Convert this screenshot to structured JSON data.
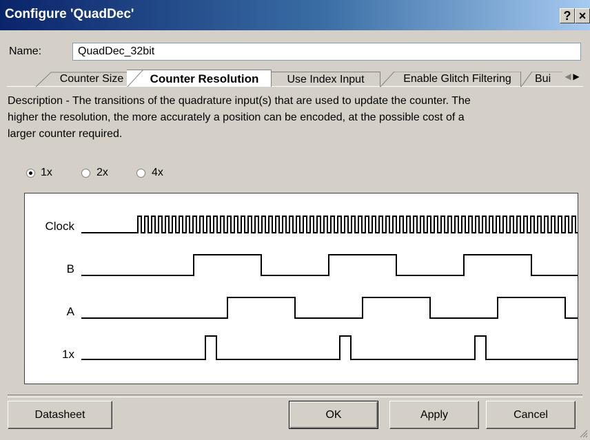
{
  "window": {
    "title": "Configure 'QuadDec'",
    "help_label": "?",
    "close_label": "×"
  },
  "name_field": {
    "label": "Name:",
    "value": "QuadDec_32bit"
  },
  "tabs": [
    {
      "label": "Counter Size"
    },
    {
      "label": "Counter Resolution"
    },
    {
      "label": "Use Index Input"
    },
    {
      "label": "Enable Glitch Filtering"
    },
    {
      "label": "Bui"
    }
  ],
  "tab_scroll_icons": [
    "arrow-left-icon",
    "arrow-right-icon"
  ],
  "description": "Description - The transitions of the quadrature input(s) that are used to update the counter. The higher the resolution, the more accurately a position can be encoded, at the possible cost of a larger counter required.",
  "resolution_options": [
    {
      "label": "1x",
      "checked": true
    },
    {
      "label": "2x",
      "checked": false
    },
    {
      "label": "4x",
      "checked": false
    }
  ],
  "waveform": {
    "signals": [
      {
        "label": "Clock"
      },
      {
        "label": "B"
      },
      {
        "label": "A"
      },
      {
        "label": "1x"
      }
    ]
  },
  "buttons": {
    "datasheet": "Datasheet",
    "ok": "OK",
    "apply": "Apply",
    "cancel": "Cancel"
  }
}
